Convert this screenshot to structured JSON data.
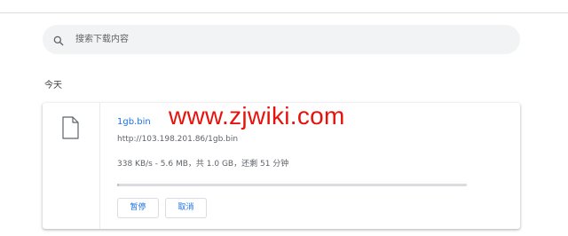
{
  "search": {
    "placeholder": "搜索下载内容"
  },
  "icons": {
    "search": "search-icon",
    "file": "file-icon"
  },
  "colors": {
    "accent": "#1a73e8",
    "watermark": "#e8120c",
    "search_bg": "#f1f3f4"
  },
  "section": {
    "title": "今天"
  },
  "download": {
    "file_name": "1gb.bin",
    "url": "http://103.198.201.86/1gb.bin",
    "status": "338 KB/s - 5.6 MB，共 1.0 GB，还剩 51 分钟",
    "progress_fraction": 0.0056,
    "pause_label": "暂停",
    "cancel_label": "取消"
  },
  "watermark": {
    "text": "www.zjwiki.com"
  }
}
